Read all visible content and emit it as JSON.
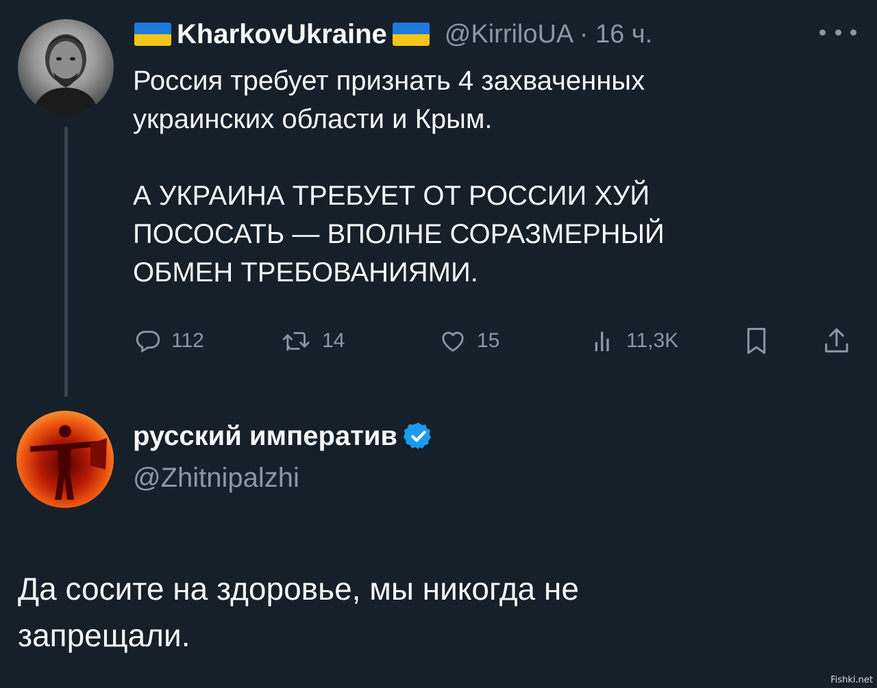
{
  "tweet": {
    "author_name": "KharkovUkraine",
    "handle": "@KirriloUA",
    "separator": "·",
    "time": "16 ч.",
    "flag_icon": "ukraine-flag-icon",
    "flag_colors": {
      "blue": "#1d7ad8",
      "yellow": "#f3c51a"
    },
    "text_lines": [
      "Россия требует признать 4 захваченных",
      "украинских области и Крым."
    ],
    "text_caps_lines": [
      "А УКРАИНА ТРЕБУЕТ ОТ РОССИИ ХУЙ",
      "ПОСОСАТЬ — ВПОЛНЕ СОРАЗМЕРНЫЙ",
      "ОБМЕН ТРЕБОВАНИЯМИ."
    ],
    "actions": {
      "replies": "112",
      "retweets": "14",
      "likes": "15",
      "views": "11,3K"
    }
  },
  "reply": {
    "author_name": "русский императив",
    "verified_color": "#1d9bf0",
    "handle": "@Zhitnipalzhi",
    "text_lines": [
      "Да сосите на здоровье, мы никогда не",
      "запрещали."
    ]
  },
  "watermark": "Fishki.net",
  "colors": {
    "background": "#15202b",
    "text": "#f7f9f9",
    "muted": "#8b98a5",
    "thread_line": "#38444d"
  }
}
